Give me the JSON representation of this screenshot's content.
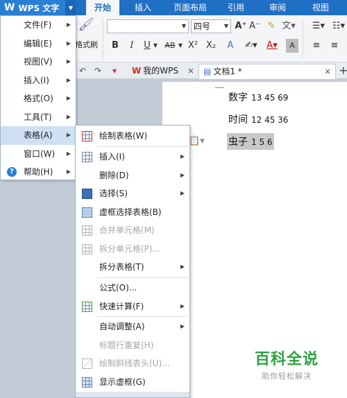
{
  "app": {
    "menu_button": "WPS 文字",
    "logo_glyph": "W"
  },
  "ribbon_tabs": [
    "开始",
    "插入",
    "页面布局",
    "引用",
    "审阅",
    "视图"
  ],
  "ribbon": {
    "format_painter_label": "格式刷",
    "font_name_value": "",
    "font_size_value": "四号",
    "bold": "B",
    "italic": "I",
    "underline": "U",
    "strike": "AB",
    "superscript": "X²",
    "subscript": "X₂"
  },
  "doc_tabs": [
    {
      "label": "我的WPS",
      "close": "×"
    },
    {
      "label": "文档1 *",
      "close": "×"
    }
  ],
  "new_tab": "+",
  "main_menu": {
    "items": [
      {
        "label": "文件(F)",
        "has_sub": true
      },
      {
        "label": "编辑(E)",
        "has_sub": true
      },
      {
        "label": "视图(V)",
        "has_sub": true
      },
      {
        "label": "插入(I)",
        "has_sub": true
      },
      {
        "label": "格式(O)",
        "has_sub": true
      },
      {
        "label": "工具(T)",
        "has_sub": true
      },
      {
        "label": "表格(A)",
        "has_sub": true,
        "active": true
      },
      {
        "label": "窗口(W)",
        "has_sub": true
      },
      {
        "label": "帮助(H)",
        "has_sub": true
      }
    ]
  },
  "table_submenu": {
    "items": [
      {
        "label": "绘制表格(W)",
        "enabled": true,
        "has_sub": false,
        "icon": "draw-table-icon"
      },
      {
        "label": "插入(I)",
        "enabled": true,
        "has_sub": true,
        "icon": "insert-table-icon"
      },
      {
        "label": "删除(D)",
        "enabled": true,
        "has_sub": true,
        "icon": ""
      },
      {
        "label": "选择(S)",
        "enabled": true,
        "has_sub": true,
        "icon": "select-table-icon"
      },
      {
        "label": "虚框选择表格(B)",
        "enabled": true,
        "has_sub": false,
        "icon": "dashed-select-icon"
      },
      {
        "label": "合并单元格(M)",
        "enabled": false,
        "has_sub": false,
        "icon": "merge-cells-icon"
      },
      {
        "label": "拆分单元格(P)...",
        "enabled": false,
        "has_sub": false,
        "icon": "split-cells-icon"
      },
      {
        "label": "拆分表格(T)",
        "enabled": true,
        "has_sub": true,
        "icon": ""
      },
      {
        "label": "公式(O)...",
        "enabled": true,
        "has_sub": false,
        "icon": ""
      },
      {
        "label": "快速计算(F)",
        "enabled": true,
        "has_sub": true,
        "icon": "quick-calc-icon"
      },
      {
        "label": "自动调整(A)",
        "enabled": true,
        "has_sub": true,
        "icon": ""
      },
      {
        "label": "标题行重复(H)",
        "enabled": false,
        "has_sub": false,
        "icon": ""
      },
      {
        "label": "绘制斜线表头(U)...",
        "enabled": false,
        "has_sub": false,
        "icon": "diagonal-header-icon"
      },
      {
        "label": "显示虚框(G)",
        "enabled": true,
        "has_sub": false,
        "icon": "show-gridlines-icon"
      }
    ]
  },
  "document": {
    "lines": [
      {
        "label": "数字",
        "nums": "13 45 69",
        "selected": false
      },
      {
        "label": "时间",
        "nums": "12 45 36",
        "selected": false
      },
      {
        "label": "虫子",
        "nums": "1 5 6",
        "selected": true
      }
    ]
  },
  "watermark": {
    "title": "百科全说",
    "subtitle": "助你轻松解决"
  },
  "colors": {
    "tab_bar": "#1f6fc5",
    "menu_highlight": "#cfe0f5",
    "watermark_green": "#2da142"
  }
}
